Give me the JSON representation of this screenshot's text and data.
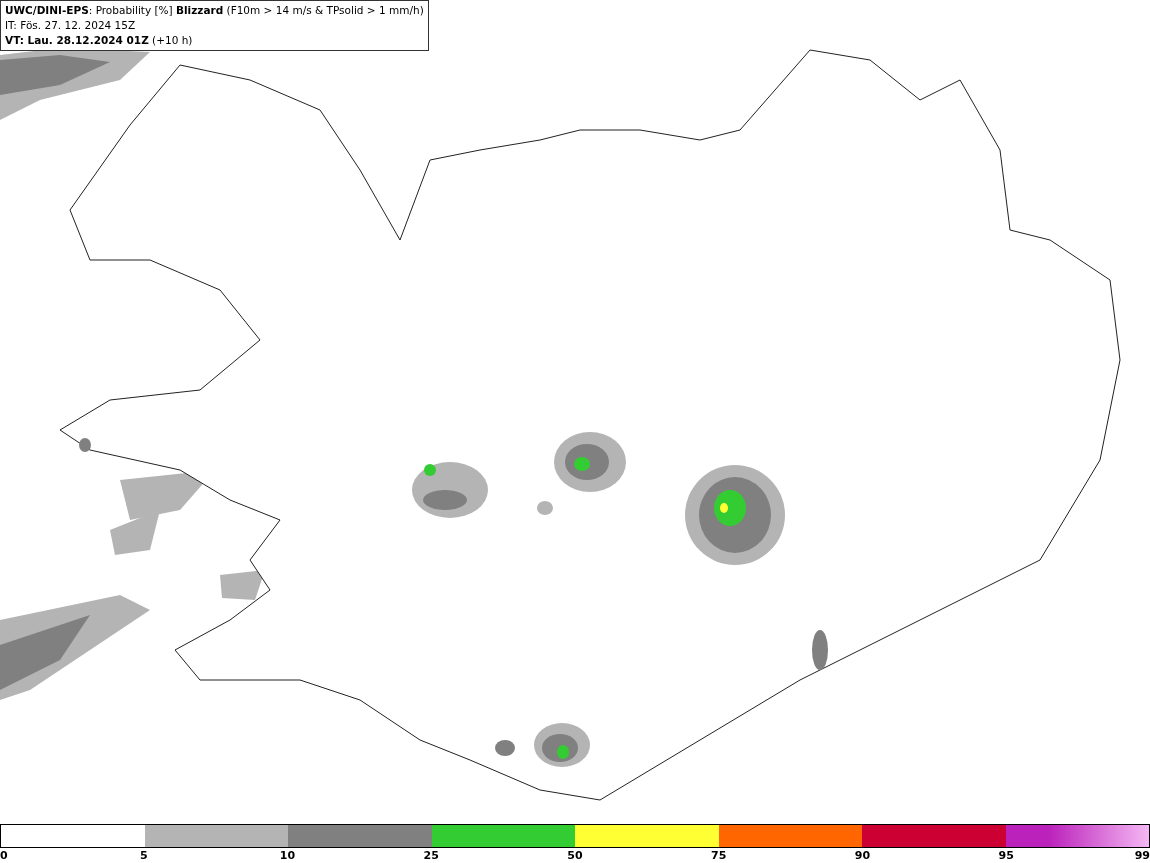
{
  "header": {
    "lines": [
      "**UWC/DINI-EPS**: Probability [%] **Blizzard** (F10m > 14 m/s & TPsolid > 1 mm/h)",
      "IT: Fös. 27. 12. 2024 15Z",
      "**VT: Lau. 28.12.2024 01Z** (+10 h)"
    ]
  },
  "legend": {
    "segments": [
      {
        "kind": "solid",
        "color": "#b4b4b4"
      },
      {
        "kind": "solid",
        "color": "#808080"
      },
      {
        "kind": "solid",
        "color": "#33cc33"
      },
      {
        "kind": "solid",
        "color": "#ffff33"
      },
      {
        "kind": "solid",
        "color": "#ff6600"
      },
      {
        "kind": "solid",
        "color": "#cc0033"
      },
      {
        "kind": "gradient",
        "color": "#bb22bb"
      }
    ],
    "ticks": [
      "0",
      "5",
      "10",
      "25",
      "50",
      "75",
      "90",
      "95",
      "99"
    ]
  }
}
